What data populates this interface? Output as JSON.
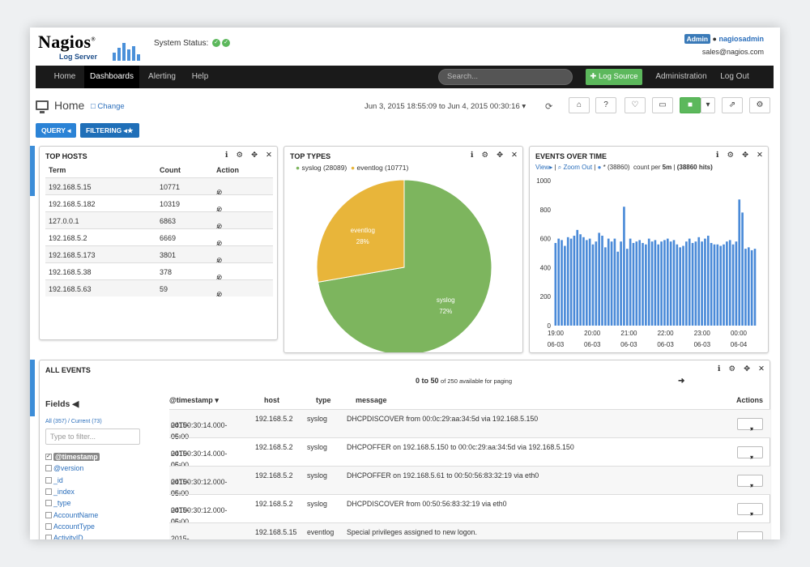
{
  "header": {
    "logo_text": "Nagios",
    "logo_sub": "Log Server",
    "system_status_label": "System Status:",
    "admin_badge": "Admin",
    "username": "nagiosadmin",
    "email": "sales@nagios.com"
  },
  "nav": {
    "items": [
      "Home",
      "Dashboards",
      "Alerting",
      "Help"
    ],
    "active": "Dashboards",
    "search_placeholder": "Search...",
    "log_source_label": "Log Source",
    "administration_label": "Administration",
    "logout_label": "Log Out"
  },
  "page": {
    "title": "Home",
    "change_label": "Change",
    "timerange": "Jun 3, 2015 18:55:09 to Jun 4, 2015 00:30:16",
    "query_label": "QUERY",
    "filtering_label": "FILTERING"
  },
  "top_hosts": {
    "title": "TOP HOSTS",
    "columns": [
      "Term",
      "Count",
      "Action"
    ],
    "rows": [
      {
        "term": "192.168.5.15",
        "count": "10771"
      },
      {
        "term": "192.168.5.182",
        "count": "10319"
      },
      {
        "term": "127.0.0.1",
        "count": "6863"
      },
      {
        "term": "192.168.5.2",
        "count": "6669"
      },
      {
        "term": "192.168.5.173",
        "count": "3801"
      },
      {
        "term": "192.168.5.38",
        "count": "378"
      },
      {
        "term": "192.168.5.63",
        "count": "59"
      }
    ]
  },
  "top_types": {
    "title": "TOP TYPES",
    "legend": [
      "syslog (28089)",
      "eventlog (10771)"
    ]
  },
  "events_over_time": {
    "title": "EVENTS OVER TIME",
    "view_label": "View",
    "zoom_out_label": "Zoom Out",
    "series_label": "* (38860)",
    "count_per_prefix": "count per",
    "count_per_value": "5m",
    "hits_label": "(38860 hits)"
  },
  "all_events": {
    "title": "ALL EVENTS",
    "paging_range": "0 to 50",
    "paging_note": "of 250 available for paging",
    "fields_label": "Fields",
    "fields_all": "All (357)",
    "fields_current": "Current (73)",
    "filter_placeholder": "Type to filter...",
    "field_list": [
      "@timestamp",
      "@version",
      "_id",
      "_index",
      "_type",
      "AccountName",
      "AccountType",
      "ActivityID"
    ],
    "columns": [
      "@timestamp",
      "host",
      "type",
      "message",
      "Actions"
    ],
    "rows": [
      {
        "ts1": "2015-06-",
        "ts2": "04T00:30:14.000-05:00",
        "host": "192.168.5.2",
        "type": "syslog",
        "message": "DHCPDISCOVER from 00:0c:29:aa:34:5d via 192.168.5.150"
      },
      {
        "ts1": "2015-06-",
        "ts2": "04T00:30:14.000-05:00",
        "host": "192.168.5.2",
        "type": "syslog",
        "message": "DHCPOFFER on 192.168.5.150 to 00:0c:29:aa:34:5d via 192.168.5.150"
      },
      {
        "ts1": "2015-06-",
        "ts2": "04T00:30:12.000-05:00",
        "host": "192.168.5.2",
        "type": "syslog",
        "message": "DHCPOFFER on 192.168.5.61 to 00:50:56:83:32:19 via eth0"
      },
      {
        "ts1": "2015-06-",
        "ts2": "04T00:30:12.000-05:00",
        "host": "192.168.5.2",
        "type": "syslog",
        "message": "DHCPDISCOVER from 00:50:56:83:32:19 via eth0"
      },
      {
        "ts1": "2015-06-",
        "ts2": "",
        "host": "192.168.5.15",
        "type": "eventlog",
        "message": "Special privileges assigned to new logon."
      }
    ]
  },
  "colors": {
    "syslog": "#7db55e",
    "eventlog": "#e8b53a",
    "bars": "#4a8ad8",
    "nav": "#1a1a1a",
    "primary": "#2b83d6"
  },
  "chart_data": [
    {
      "type": "pie",
      "title": "TOP TYPES",
      "categories": [
        "syslog",
        "eventlog"
      ],
      "values": [
        28089,
        10771
      ],
      "labels": [
        "72%",
        "28%"
      ]
    },
    {
      "type": "bar",
      "title": "EVENTS OVER TIME",
      "ylim": [
        0,
        1000
      ],
      "yticks": [
        "0",
        "200",
        "400",
        "600",
        "800",
        "1000"
      ],
      "xticks": [
        [
          "19:00",
          "06-03"
        ],
        [
          "20:00",
          "06-03"
        ],
        [
          "21:00",
          "06-03"
        ],
        [
          "22:00",
          "06-03"
        ],
        [
          "23:00",
          "06-03"
        ],
        [
          "00:00",
          "06-04"
        ]
      ],
      "values": [
        570,
        600,
        590,
        550,
        610,
        600,
        620,
        660,
        630,
        610,
        590,
        600,
        560,
        580,
        640,
        620,
        540,
        600,
        580,
        600,
        510,
        580,
        820,
        530,
        600,
        570,
        580,
        590,
        570,
        560,
        600,
        580,
        590,
        560,
        580,
        590,
        600,
        580,
        590,
        560,
        540,
        550,
        580,
        600,
        570,
        580,
        610,
        580,
        600,
        620,
        570,
        560,
        560,
        550,
        560,
        580,
        590,
        560,
        580,
        870,
        780,
        530,
        540,
        520,
        530
      ]
    }
  ]
}
